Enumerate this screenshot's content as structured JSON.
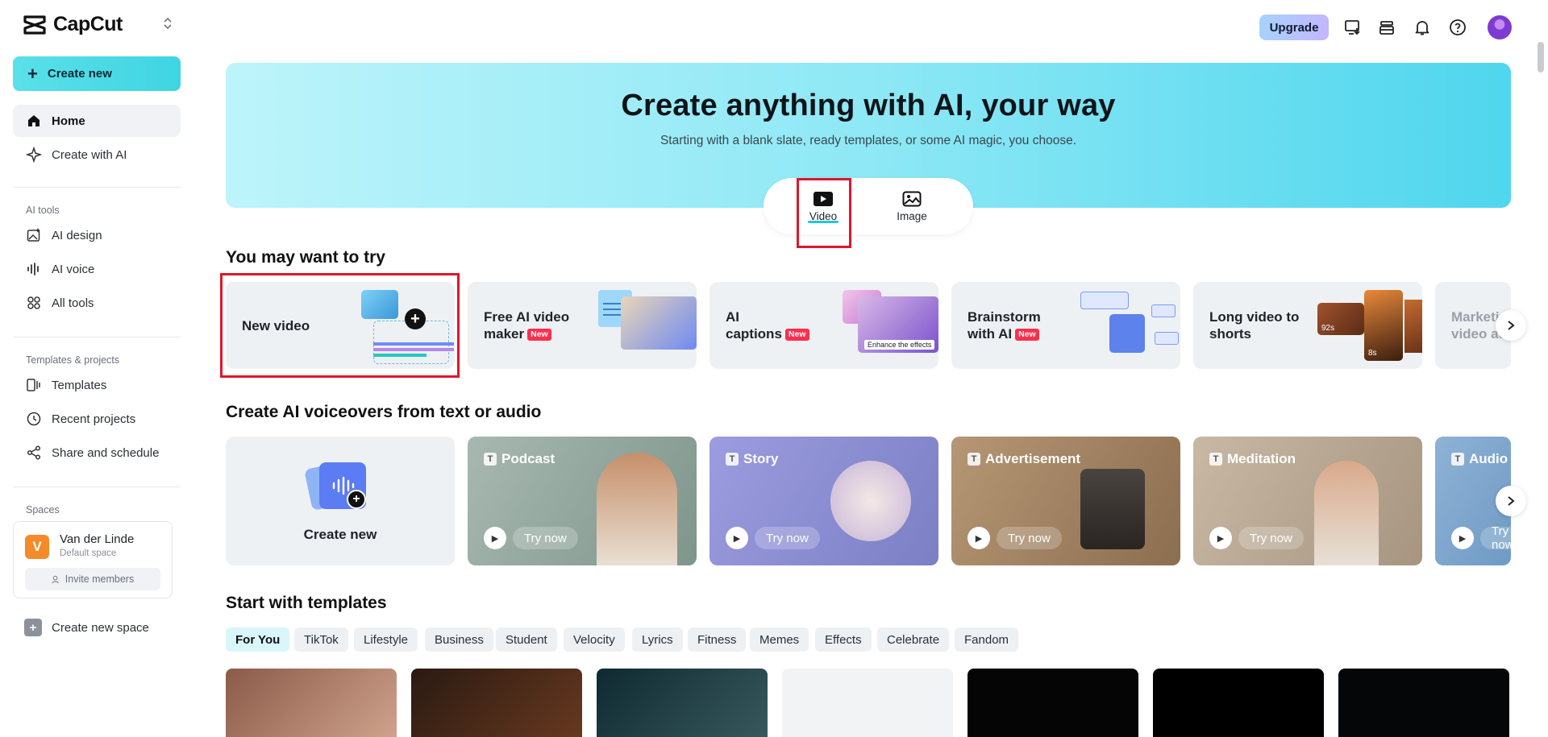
{
  "brand": {
    "name": "CapCut"
  },
  "sidebar": {
    "create_new": "Create new",
    "main_items": [
      {
        "label": "Home",
        "icon": "home-icon",
        "active": true
      },
      {
        "label": "Create with AI",
        "icon": "sparkle-icon",
        "active": false
      }
    ],
    "ai_tools_title": "AI tools",
    "ai_tools": [
      {
        "label": "AI design",
        "icon": "image-ai-icon"
      },
      {
        "label": "AI voice",
        "icon": "waveform-icon"
      },
      {
        "label": "All tools",
        "icon": "grid-icon"
      }
    ],
    "templates_title": "Templates & projects",
    "templates_items": [
      {
        "label": "Templates",
        "icon": "templates-icon"
      },
      {
        "label": "Recent projects",
        "icon": "clock-icon"
      },
      {
        "label": "Share and schedule",
        "icon": "share-icon"
      }
    ],
    "spaces_title": "Spaces",
    "space": {
      "initial": "V",
      "name": "Van der Linde",
      "subtitle": "Default space",
      "invite": "Invite members"
    },
    "create_space": "Create new space"
  },
  "topbar": {
    "upgrade": "Upgrade"
  },
  "hero": {
    "title": "Create anything with AI, your way",
    "subtitle": "Starting with a blank slate, ready templates, or some AI magic, you choose.",
    "tabs": [
      {
        "label": "Video",
        "active": true
      },
      {
        "label": "Image",
        "active": false
      }
    ]
  },
  "try_section": {
    "title": "You may want to try",
    "cards": [
      {
        "line1": "New video",
        "line2": "",
        "badge": ""
      },
      {
        "line1": "Free AI video",
        "line2": "maker",
        "badge": "New"
      },
      {
        "line1": "AI",
        "line2": "captions",
        "badge": "New"
      },
      {
        "line1": "Brainstorm",
        "line2": "with AI",
        "badge": "New"
      },
      {
        "line1": "Long video to",
        "line2": "shorts",
        "badge": ""
      },
      {
        "line1": "Marketing",
        "line2": "video ads",
        "badge": ""
      }
    ],
    "thumb_texts": {
      "enhance": "Enhance the effects",
      "dur1": "92s",
      "dur2": "8s"
    }
  },
  "voice_section": {
    "title": "Create AI voiceovers from text or audio",
    "create_label": "Create new",
    "cards": [
      {
        "title": "Podcast",
        "action": "Try now",
        "color": "#8fa39b"
      },
      {
        "title": "Story",
        "action": "Try now",
        "color": "#8b8ad0"
      },
      {
        "title": "Advertisement",
        "action": "Try now",
        "color": "#a68b6c"
      },
      {
        "title": "Meditation",
        "action": "Try now",
        "color": "#b3a08b"
      },
      {
        "title": "Audio",
        "action": "Try now",
        "color": "#6f9ac4"
      }
    ]
  },
  "templates_section": {
    "title": "Start with templates",
    "chips": [
      "For You",
      "TikTok",
      "Lifestyle",
      "Business",
      "Student",
      "Velocity",
      "Lyrics",
      "Fitness",
      "Memes",
      "Effects",
      "Celebrate",
      "Fandom"
    ],
    "active_chip": "For You"
  },
  "colors": {
    "accent": "#22c6dd",
    "highlight": "#e0162b",
    "new_badge": "#ff2e4d"
  }
}
